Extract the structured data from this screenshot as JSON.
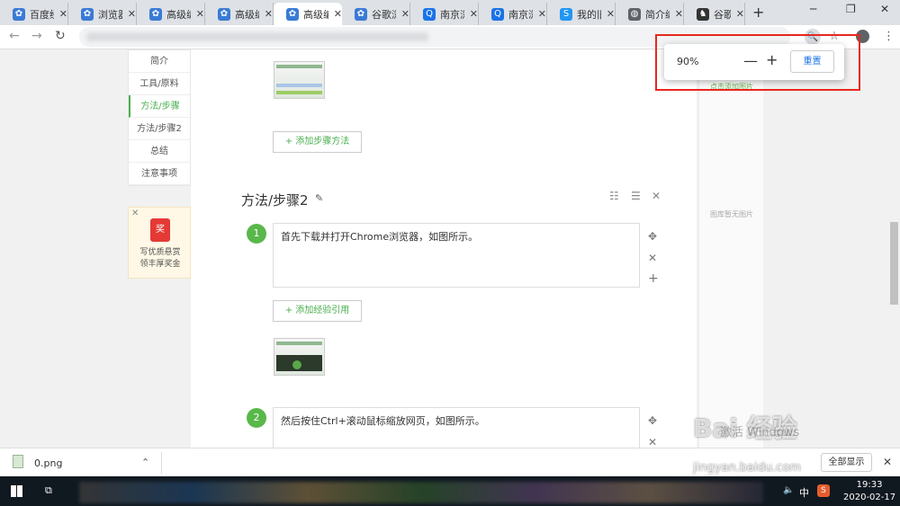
{
  "browser": {
    "tabs": [
      {
        "title": "百度经",
        "color": "#3a7bd5",
        "icon": "baidu-paw-icon"
      },
      {
        "title": "浏览器",
        "color": "#3a7bd5",
        "icon": "baidu-paw-icon"
      },
      {
        "title": "高级编",
        "color": "#3a7bd5",
        "icon": "baidu-paw-icon"
      },
      {
        "title": "高级编",
        "color": "#3a7bd5",
        "icon": "baidu-paw-icon"
      },
      {
        "title": "高级编",
        "color": "#3a7bd5",
        "icon": "baidu-paw-icon",
        "active": true
      },
      {
        "title": "谷歌浏",
        "color": "#3a7bd5",
        "icon": "baidu-paw-icon"
      },
      {
        "title": "南京浏",
        "color": "#1a73e8",
        "icon": "q-icon"
      },
      {
        "title": "南京浏",
        "color": "#1a73e8",
        "icon": "q-icon"
      },
      {
        "title": "我的旧",
        "color": "#2196f3",
        "icon": "sogou-icon"
      },
      {
        "title": "简介编",
        "color": "#5f6368",
        "icon": "globe-icon"
      },
      {
        "title": "谷歌浏",
        "color": "#333333",
        "icon": "figure-icon"
      }
    ],
    "zoom": {
      "value": "90%",
      "minus": "—",
      "plus": "+",
      "reset": "重置"
    }
  },
  "leftnav": {
    "items": [
      "简介",
      "工具/原料",
      "方法/步骤",
      "方法/步骤2",
      "总结",
      "注意事项"
    ],
    "active_index": 2
  },
  "reward": {
    "badge": "奖",
    "line1": "写优质悬赏",
    "line2": "领丰厚奖金"
  },
  "section": {
    "title": "方法/步骤2",
    "add_step_method": "+ 添加步骤方法",
    "add_exp_ref": "+ 添加经验引用",
    "steps": [
      {
        "num": "1",
        "text": "首先下载并打开Chrome浏览器，如图所示。"
      },
      {
        "num": "2",
        "text": "然后按住Ctrl+滚动鼠标缩放网页，如图所示。"
      }
    ]
  },
  "sidebar": {
    "partial_text": "点击添加图片",
    "no_image": "图库暂无图片"
  },
  "download": {
    "filename": "0.png",
    "show_all": "全部显示"
  },
  "taskbar": {
    "ime": "中",
    "ime_icon": "S",
    "time": "19:33",
    "date": "2020-02-17"
  },
  "watermark": {
    "brand": "Bai 经验",
    "sub": "jingyan.baidu.com",
    "activate": "激活 Windows"
  }
}
